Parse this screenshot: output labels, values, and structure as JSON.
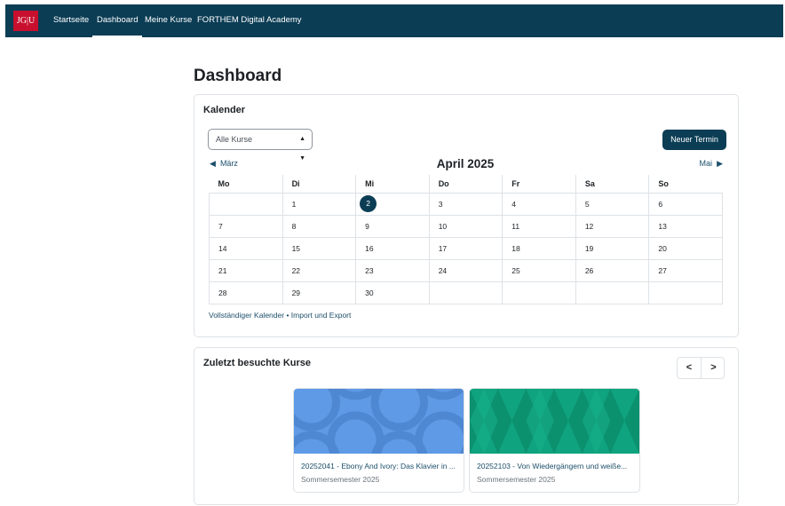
{
  "navbar": {
    "logo_text": "JG|U",
    "items": [
      {
        "label": "Startseite",
        "active": false
      },
      {
        "label": "Dashboard",
        "active": true
      },
      {
        "label": "Meine Kurse",
        "active": false
      },
      {
        "label": "FORTHEM Digital Academy",
        "active": false
      }
    ],
    "bg_color": "#0b3d55"
  },
  "page_title": "Dashboard",
  "calendar": {
    "title": "Kalender",
    "course_filter": "Alle Kurse",
    "new_event_label": "Neuer Termin",
    "prev_month": "März",
    "next_month": "Mai",
    "month_title": "April 2025",
    "weekdays": [
      "Mo",
      "Di",
      "Mi",
      "Do",
      "Fr",
      "Sa",
      "So"
    ],
    "weeks": [
      [
        "",
        "1",
        "2",
        "3",
        "4",
        "5",
        "6"
      ],
      [
        "7",
        "8",
        "9",
        "10",
        "11",
        "12",
        "13"
      ],
      [
        "14",
        "15",
        "16",
        "17",
        "18",
        "19",
        "20"
      ],
      [
        "21",
        "22",
        "23",
        "24",
        "25",
        "26",
        "27"
      ],
      [
        "28",
        "29",
        "30",
        "",
        "",
        "",
        ""
      ]
    ],
    "today": "2",
    "full_calendar_link": "Vollständiger Kalender",
    "separator": "•",
    "import_export_link": "Import und Export"
  },
  "recent_courses": {
    "title": "Zuletzt besuchte Kurse",
    "prev_icon": "chevron-left-icon",
    "next_icon": "chevron-right-icon",
    "courses": [
      {
        "name": "20252041 - Ebony And Ivory: Das Klavier in ...",
        "term": "Sommersemester 2025",
        "color": "#5e9ae6"
      },
      {
        "name": "20252103 - Von Wiedergängern und weiße...",
        "term": "Sommersemester 2025",
        "color": "#0fa37f"
      }
    ]
  }
}
